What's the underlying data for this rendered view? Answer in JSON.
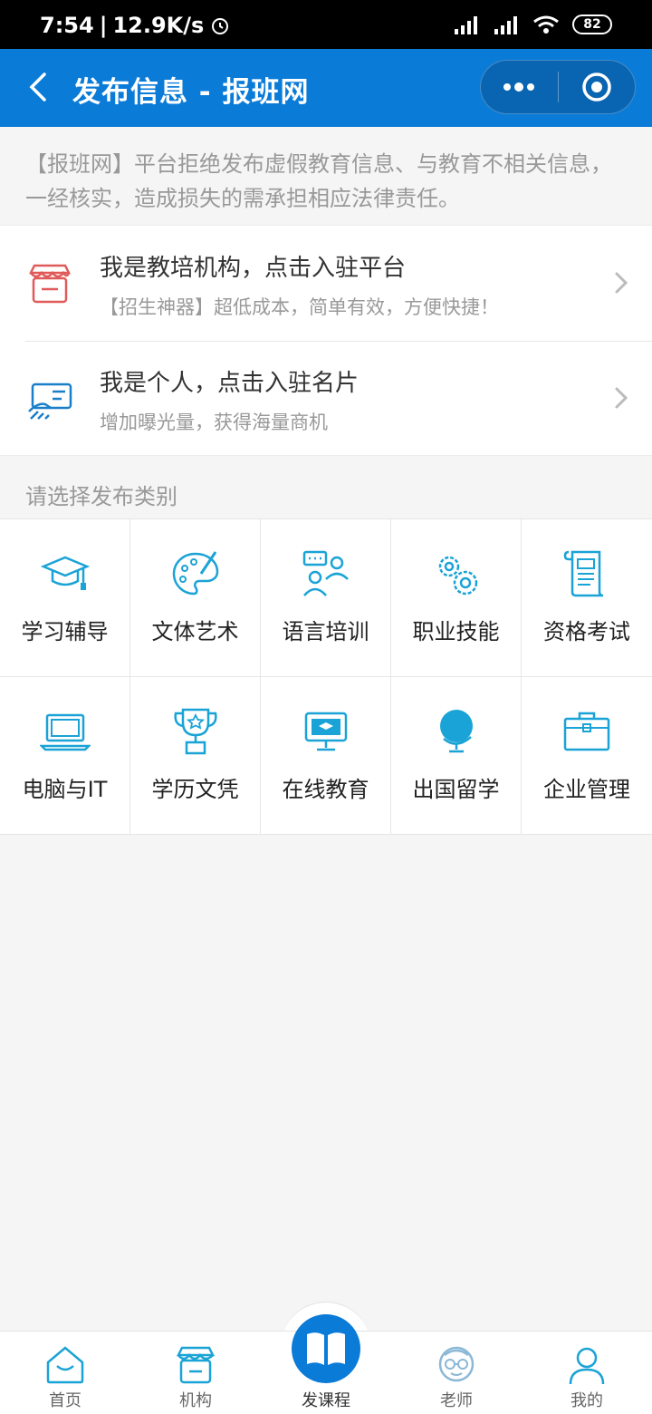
{
  "status_bar": {
    "time": "7:54",
    "speed": "12.9K/s",
    "battery": "82"
  },
  "nav": {
    "title": "发布信息 - 报班网"
  },
  "notice": {
    "text": "【报班网】平台拒绝发布虚假教育信息、与教育不相关信息，一经核实，造成损失的需承担相应法律责任。"
  },
  "entries": [
    {
      "title": "我是教培机构，点击入驻平台",
      "subtitle": "【招生神器】超低成本，简单有效，方便快捷！",
      "icon": "storefront-icon"
    },
    {
      "title": "我是个人，点击入驻名片",
      "subtitle": "增加曝光量，获得海量商机",
      "icon": "business-card-icon"
    }
  ],
  "section": {
    "title": "请选择发布类别"
  },
  "categories": [
    {
      "label": "学习辅导",
      "icon": "graduation-cap-icon"
    },
    {
      "label": "文体艺术",
      "icon": "palette-icon"
    },
    {
      "label": "语言培训",
      "icon": "people-chat-icon"
    },
    {
      "label": "职业技能",
      "icon": "gears-icon"
    },
    {
      "label": "资格考试",
      "icon": "scroll-icon"
    },
    {
      "label": "电脑与IT",
      "icon": "laptop-icon"
    },
    {
      "label": "学历文凭",
      "icon": "trophy-icon"
    },
    {
      "label": "在线教育",
      "icon": "monitor-icon"
    },
    {
      "label": "出国留学",
      "icon": "globe-icon"
    },
    {
      "label": "企业管理",
      "icon": "toolbox-icon"
    }
  ],
  "tabs": [
    {
      "label": "首页",
      "icon": "home-icon"
    },
    {
      "label": "机构",
      "icon": "store-icon"
    },
    {
      "label": "发课程",
      "icon": "book-icon"
    },
    {
      "label": "老师",
      "icon": "teacher-icon"
    },
    {
      "label": "我的",
      "icon": "user-icon"
    }
  ],
  "colors": {
    "brand": "#0b7bd8",
    "accent_icon": "#1aa3d6",
    "entry_red": "#e05a5a"
  }
}
